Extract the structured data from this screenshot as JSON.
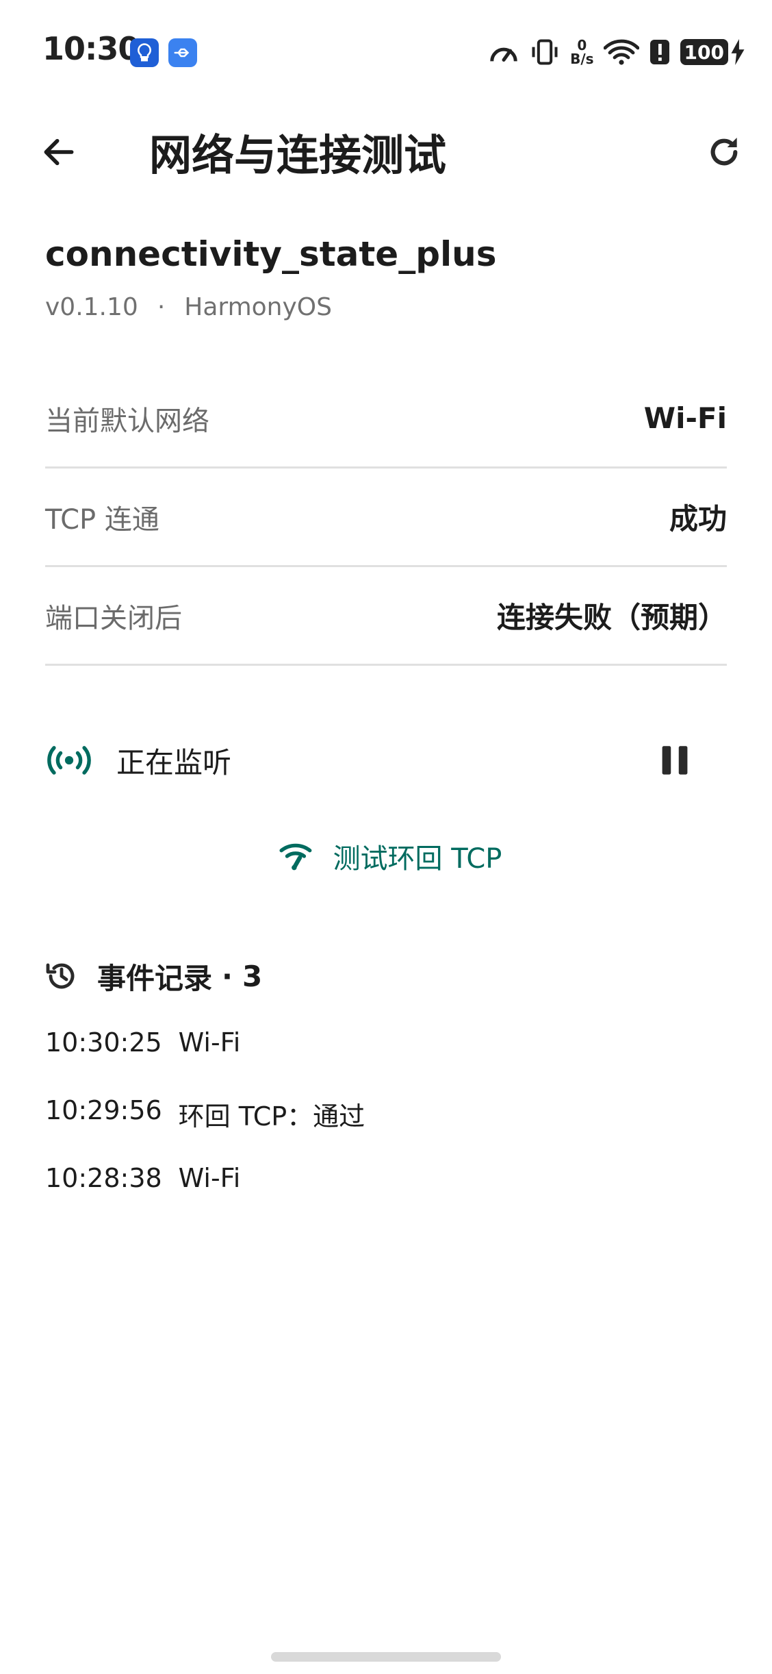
{
  "status_bar": {
    "time": "10:30",
    "network_speed_value": "0",
    "network_speed_unit": "B/s",
    "battery": "100"
  },
  "app_bar": {
    "title": "网络与连接测试"
  },
  "package": {
    "name": "connectivity_state_plus",
    "version": "v0.1.10",
    "separator": "·",
    "platform": "HarmonyOS"
  },
  "info_rows": [
    {
      "label": "当前默认网络",
      "value": "Wi-Fi"
    },
    {
      "label": "TCP 连通",
      "value": "成功"
    },
    {
      "label": "端口关闭后",
      "value": "连接失败（预期）"
    }
  ],
  "listening": {
    "label": "正在监听",
    "icon": "broadcast-icon",
    "action_icon": "pause-icon"
  },
  "test_button": {
    "label": "测试环回 TCP",
    "icon": "network-check-icon"
  },
  "event_log": {
    "title": "事件记录",
    "separator": "·",
    "count": "3",
    "icon": "history-icon",
    "items": [
      {
        "time": "10:30:25",
        "text": "Wi-Fi"
      },
      {
        "time": "10:29:56",
        "text": "环回 TCP：通过"
      },
      {
        "time": "10:28:38",
        "text": "Wi-Fi"
      }
    ]
  },
  "colors": {
    "accent": "#006b5f",
    "text_primary": "#1c1c1c",
    "text_secondary": "#6b6b6b",
    "divider": "#e0e0e0",
    "status_icon_blue": "#2f6fe8"
  }
}
